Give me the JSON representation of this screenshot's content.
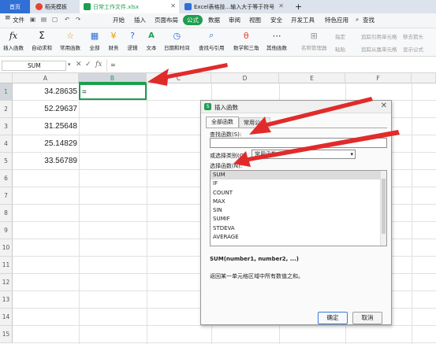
{
  "tabs": [
    {
      "label": "首页",
      "active": true
    },
    {
      "label": "稻壳模板"
    },
    {
      "label": "日常工作文件.xlsx"
    },
    {
      "label": "Excel表格技...输入大于等于符号"
    }
  ],
  "menu": {
    "file": "文件",
    "items": [
      "开始",
      "插入",
      "页面布局",
      "公式",
      "数据",
      "审阅",
      "视图",
      "安全",
      "开发工具",
      "特色应用"
    ],
    "active_item": "公式",
    "search": "查找"
  },
  "ribbon": {
    "buttons": [
      "插入函数",
      "自动求和",
      "常用函数",
      "全部",
      "财务",
      "逻辑",
      "文本",
      "日期和时间",
      "查找与引用",
      "数学和三角",
      "其他函数",
      "名称管理器"
    ],
    "small": [
      "指定",
      "粘贴",
      "追踪引用单元格",
      "追踪从属单元格",
      "移去箭头",
      "显示公式"
    ]
  },
  "formula_bar": {
    "name_box": "SUM",
    "fx": "fx",
    "content": "="
  },
  "sheet": {
    "columns": [
      "A",
      "B",
      "C",
      "D",
      "E",
      "F"
    ],
    "rows": [
      "1",
      "2",
      "3",
      "4",
      "5",
      "6",
      "7",
      "8",
      "9",
      "10",
      "11",
      "12",
      "13",
      "14",
      "15"
    ],
    "values": [
      "34.28635",
      "52.29637",
      "31.25648",
      "25.14829",
      "33.56789"
    ],
    "active_cell_value": "="
  },
  "dialog": {
    "title": "插入函数",
    "tab_all": "全部函数",
    "tab_common": "常用公式",
    "search_label": "查找函数(S):",
    "category_label": "或选择类别(C):",
    "category_value": "常用函数",
    "list_label": "选择函数(N):",
    "functions": [
      "SUM",
      "IF",
      "COUNT",
      "MAX",
      "SIN",
      "SUMIF",
      "STDEVA",
      "AVERAGE"
    ],
    "signature": "SUM(number1, number2, ...)",
    "description": "返回某一单元格区域中所有数值之和。",
    "ok": "确定",
    "cancel": "取消"
  },
  "colors": {
    "accent": "#1e9e4e",
    "arrow": "#e12b2b",
    "tabbar": "#dde3ec"
  }
}
